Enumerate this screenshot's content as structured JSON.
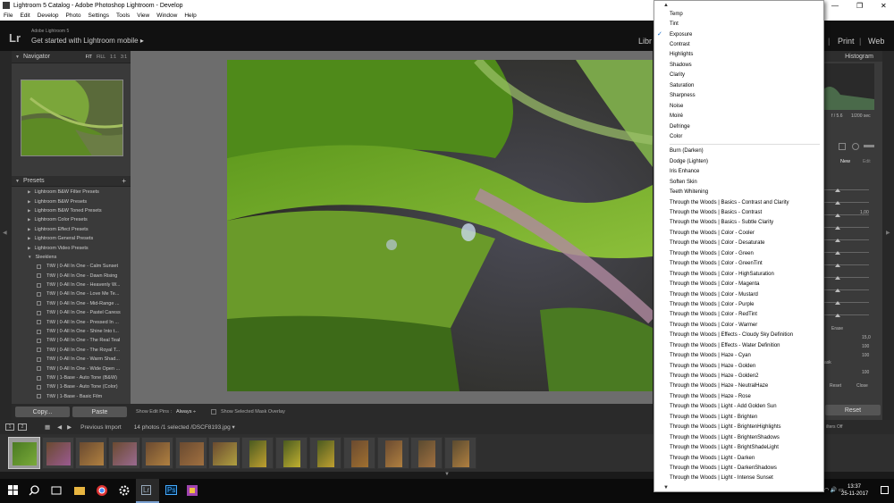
{
  "window": {
    "title": "Lightroom 5 Catalog - Adobe Photoshop Lightroom - Develop",
    "close_glyph": "✕",
    "max_glyph": "❐",
    "min_glyph": "—"
  },
  "menu": [
    "File",
    "Edit",
    "Develop",
    "Photo",
    "Settings",
    "Tools",
    "View",
    "Window",
    "Help"
  ],
  "identity": {
    "logo": "Lr",
    "product": "Adobe Lightroom 5",
    "tagline": "Get started with Lightroom mobile ▸"
  },
  "modules": {
    "library": "Libr",
    "print": "Print",
    "web": "Web",
    "sep": "|"
  },
  "navigator": {
    "title": "Navigator",
    "fit": "FIT",
    "fill": "FILL",
    "one": "1:1",
    "three": "3:1"
  },
  "presets": {
    "title": "Presets",
    "items": [
      {
        "label": "Lightroom B&W Filter Presets",
        "type": "folder"
      },
      {
        "label": "Lightroom B&W Presets",
        "type": "folder"
      },
      {
        "label": "Lightroom B&W Toned Presets",
        "type": "folder"
      },
      {
        "label": "Lightroom Color Presets",
        "type": "folder"
      },
      {
        "label": "Lightroom Effect Presets",
        "type": "folder"
      },
      {
        "label": "Lightroom General Presets",
        "type": "folder"
      },
      {
        "label": "Lightroom Video Presets",
        "type": "folder"
      },
      {
        "label": "Sleeklens",
        "type": "open"
      },
      {
        "label": "TtW | 0-All In One - Calm Sunset",
        "type": "preset"
      },
      {
        "label": "TtW | 0-All In One - Dawn Rising",
        "type": "preset"
      },
      {
        "label": "TtW | 0-All In One - Heavenly W...",
        "type": "preset"
      },
      {
        "label": "TtW | 0-All In One - Love Me Te...",
        "type": "preset"
      },
      {
        "label": "TtW | 0-All In One - Mid-Range ...",
        "type": "preset"
      },
      {
        "label": "TtW | 0-All In One - Pastel Caress",
        "type": "preset"
      },
      {
        "label": "TtW | 0-All In One - Pressed In ...",
        "type": "preset"
      },
      {
        "label": "TtW | 0-All In One - Shine Into t...",
        "type": "preset"
      },
      {
        "label": "TtW | 0-All In One - The Real Teal",
        "type": "preset"
      },
      {
        "label": "TtW | 0-All In One - The Royal T...",
        "type": "preset"
      },
      {
        "label": "TtW | 0-All In One - Warm Shad...",
        "type": "preset"
      },
      {
        "label": "TtW | 0-All In One - Wide Open ...",
        "type": "preset"
      },
      {
        "label": "TtW | 1-Base - Auto Tone (B&W)",
        "type": "preset"
      },
      {
        "label": "TtW | 1-Base - Auto Tone (Color)",
        "type": "preset"
      },
      {
        "label": "TtW | 1-Base - Basic Film",
        "type": "preset"
      }
    ]
  },
  "left_buttons": {
    "copy": "Copy...",
    "paste": "Paste"
  },
  "toolbar": {
    "show_pins": "Show Edit Pins :",
    "pins_value": "Always ÷",
    "mask_overlay": "Show Selected Mask Overlay"
  },
  "right_panel": {
    "histogram": "Histogram",
    "aperture": "f / 5.6",
    "shutter": "1/200 sec",
    "new": "New",
    "edit": "Edit",
    "value_1": "1,00",
    "value_2": "15,0",
    "value_3": "100",
    "value_4": "100",
    "value_5": "100",
    "erase": "Erase",
    "mask": "ask",
    "reset_small": "Reset",
    "close": "Close",
    "reset": "Reset",
    "filters": "ilters Off"
  },
  "filmstrip": {
    "page1": "1",
    "page2": "2",
    "source": "Previous Import",
    "info": "14 photos /1 selected /",
    "file": "DSCF8193.jpg ▾",
    "count": 14
  },
  "dropdown": {
    "up_arrow": "▲",
    "down_arrow": "▼",
    "check_glyph": "✓",
    "group1": [
      "Temp",
      "Tint",
      "Exposure",
      "Contrast",
      "Highlights",
      "Shadows",
      "Clarity",
      "Saturation",
      "Sharpness",
      "Noise",
      "Moiré",
      "Defringe",
      "Color"
    ],
    "checked": "Exposure",
    "group2": [
      "Burn (Darken)",
      "Dodge (Lighten)",
      "Iris Enhance",
      "Soften Skin",
      "Teeth Whitening",
      "Through the Woods | Basics - Contrast and Clarity",
      "Through the Woods | Basics - Contrast",
      "Through the Woods | Basics - Subtle Clarity",
      "Through the Woods | Color - Cooler",
      "Through the Woods | Color - Desaturate",
      "Through the Woods | Color - Green",
      "Through the Woods | Color - GreenTint",
      "Through the Woods | Color - HighSaturation",
      "Through the Woods | Color - Magenta",
      "Through the Woods | Color - Mustard",
      "Through the Woods | Color - Purple",
      "Through the Woods | Color - RedTint",
      "Through the Woods | Color - Warmer",
      "Through the Woods | Effects - Cloudy Sky Definition",
      "Through the Woods | Effects - Water Definition",
      "Through the Woods | Haze - Cyan",
      "Through the Woods | Haze - Golden",
      "Through the Woods | Haze - Golden2",
      "Through the Woods | Haze - NeutralHaze",
      "Through the Woods | Haze - Rose",
      "Through the Woods | Light - Add Golden Sun",
      "Through the Woods | Light - Brighten",
      "Through the Woods | Light - BrightenHighlights",
      "Through the Woods | Light - BrightenShadows",
      "Through the Woods | Light - BrightShadeLight",
      "Through the Woods | Light - Darken",
      "Through the Woods | Light - DarkenShadows",
      "Through the Woods | Light - Intense Sunset"
    ]
  },
  "taskbar": {
    "time": "13:37",
    "date": "25-11-2017",
    "lr": "Lr",
    "ps": "Ps"
  }
}
